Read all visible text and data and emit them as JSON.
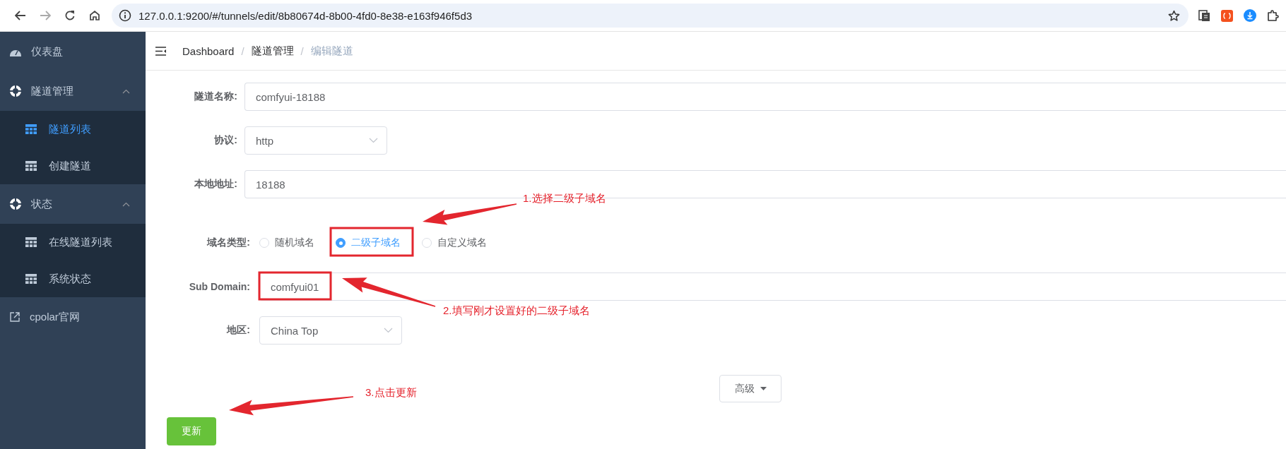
{
  "browser": {
    "url": "127.0.0.1:9200/#/tunnels/edit/8b80674d-8b00-4fd0-8e38-e163f946f5d3"
  },
  "sidebar": {
    "items": [
      {
        "kind": "item",
        "label": "仪表盘"
      },
      {
        "kind": "group",
        "label": "隧道管理",
        "expanded": true,
        "children": [
          {
            "label": "隧道列表",
            "selected": true
          },
          {
            "label": "创建隧道",
            "selected": false
          }
        ]
      },
      {
        "kind": "group",
        "label": "状态",
        "expanded": true,
        "children": [
          {
            "label": "在线隧道列表",
            "selected": false
          },
          {
            "label": "系统状态",
            "selected": false
          }
        ]
      },
      {
        "kind": "external",
        "label": "cpolar官网"
      }
    ]
  },
  "breadcrumb": {
    "items": [
      {
        "label": "Dashboard",
        "current": false
      },
      {
        "label": "隧道管理",
        "current": false
      },
      {
        "label": "编辑隧道",
        "current": true
      }
    ],
    "separators": [
      "/",
      "/"
    ]
  },
  "basic_form": [
    {
      "kind": "input",
      "label": "隧道名称:",
      "value": "comfyui-18188"
    },
    {
      "kind": "select",
      "label": "协议:",
      "value": "http"
    },
    {
      "kind": "input",
      "label": "本地地址:",
      "value": "18188"
    }
  ],
  "domain_form": [
    {
      "kind": "radio",
      "label": "域名类型:",
      "options": [
        {
          "label": "随机域名",
          "selected": false
        },
        {
          "label": "二级子域名",
          "selected": true
        },
        {
          "label": "自定义域名",
          "selected": false
        }
      ]
    },
    {
      "kind": "input",
      "label": "Sub Domain:",
      "value": "comfyui01"
    },
    {
      "kind": "select",
      "label": "地区:",
      "value": "China Top"
    }
  ],
  "advanced_button": {
    "label": "高级"
  },
  "submit_button": {
    "label": "更新"
  },
  "annotations": [
    {
      "text": "1.选择二级子域名"
    },
    {
      "text": "2.填写刚才设置好的二级子域名"
    },
    {
      "text": "3.点击更新"
    }
  ]
}
